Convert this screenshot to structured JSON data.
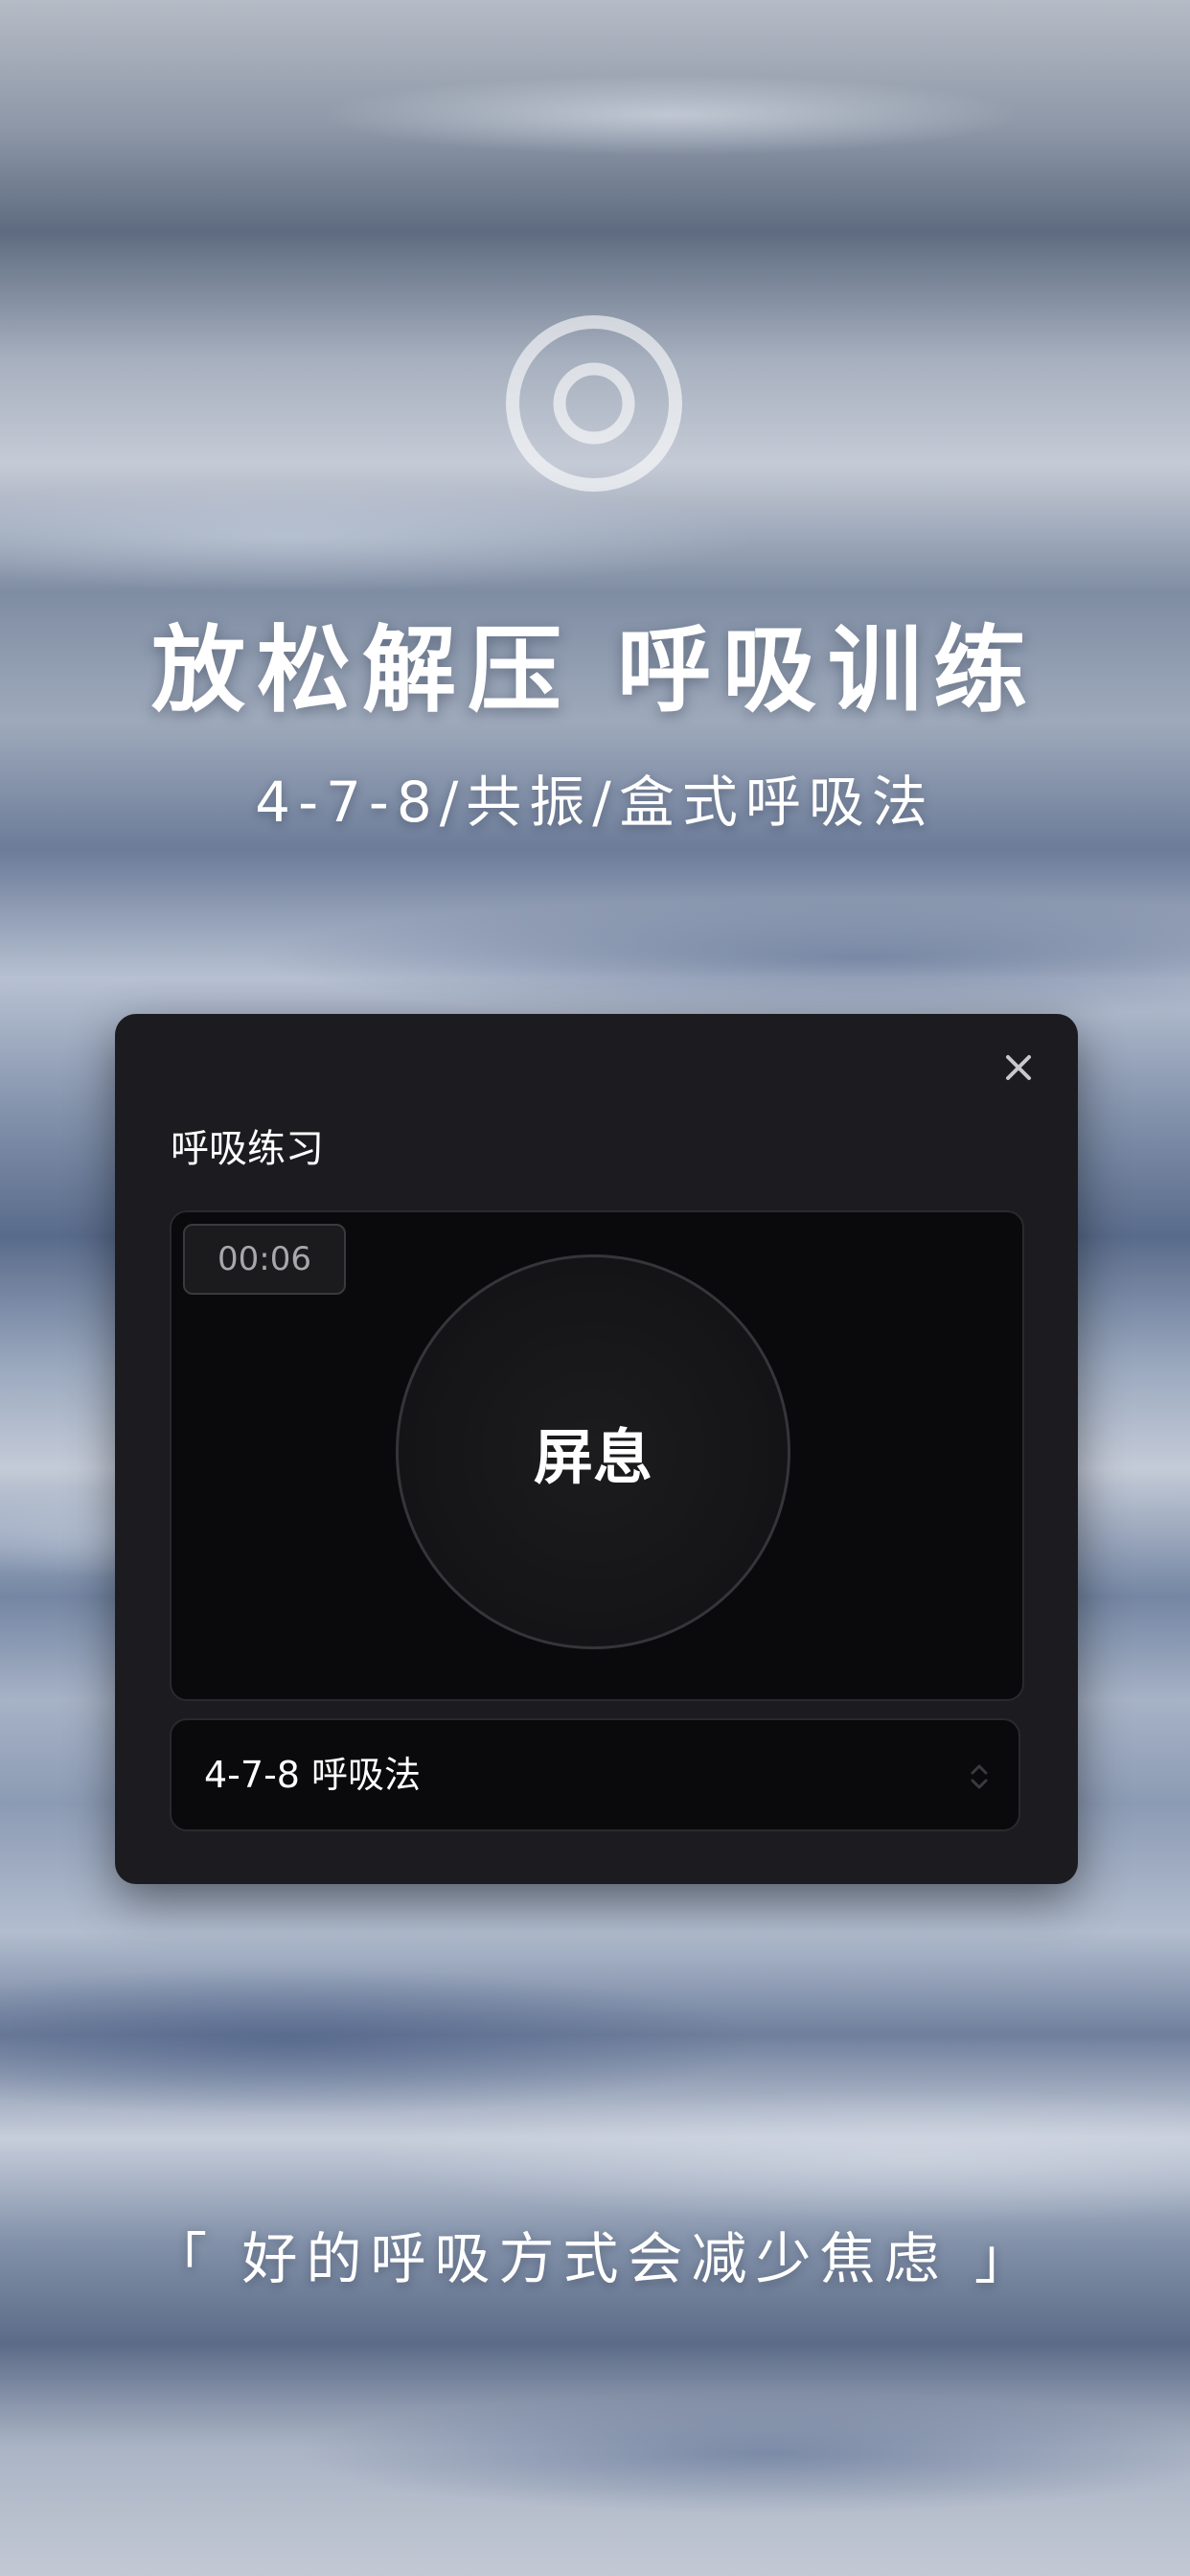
{
  "hero": {
    "logo_icon": "concentric-circle-icon",
    "headline": "放松解压 呼吸训练",
    "subheadline": "4-7-8/共振/盒式呼吸法"
  },
  "dialog": {
    "title": "呼吸练习",
    "close_icon": "close-icon",
    "timer": "00:06",
    "phase": "屏息",
    "method_select": {
      "selected": "4-7-8 呼吸法",
      "arrow_icon": "select-updown-icon"
    }
  },
  "footer": {
    "quote": "「 好的呼吸方式会减少焦虑 」"
  },
  "colors": {
    "dialog_bg": "#1c1c20",
    "stage_bg": "#0a0a0c",
    "text_primary": "#ffffff",
    "text_muted": "#a8a8ac"
  }
}
